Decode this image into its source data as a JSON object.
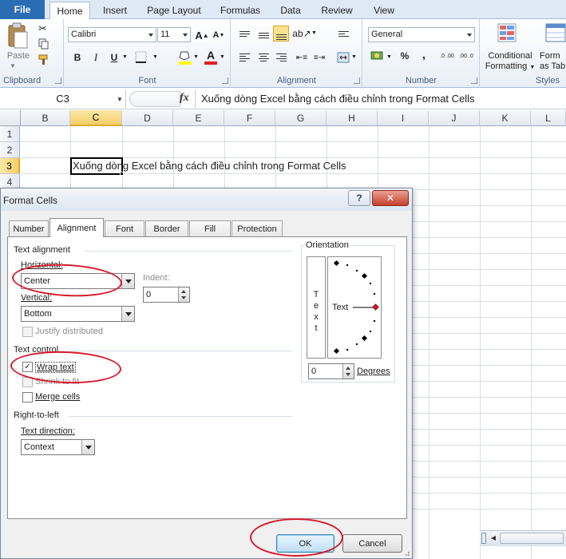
{
  "ribbon_tabs": [
    "File",
    "Home",
    "Insert",
    "Page Layout",
    "Formulas",
    "Data",
    "Review",
    "View"
  ],
  "ribbon": {
    "clipboard": {
      "paste_label": "Paste",
      "group_label": "Clipboard"
    },
    "font": {
      "font_name": "Calibri",
      "font_size": "11",
      "bold": "B",
      "italic": "I",
      "underline": "U",
      "grow": "A",
      "shrink": "A",
      "font_color_letter": "A",
      "group_label": "Font"
    },
    "alignment": {
      "group_label": "Alignment"
    },
    "number": {
      "format": "General",
      "percent": "%",
      "comma": ",",
      "inc_dec": ".0 .00",
      "dec_dec": ".00 .0",
      "group_label": "Number"
    },
    "styles": {
      "conditional_formatting": [
        "Conditional",
        "Formatting"
      ],
      "format_as_table": [
        "Form",
        "as Tab"
      ],
      "group_label": "Styles"
    }
  },
  "formula_bar": {
    "name_box": "C3",
    "fx": "fx",
    "formula": "Xuống dòng Excel bằng cách điều chỉnh trong Format Cells"
  },
  "sheet": {
    "columns": [
      "B",
      "C",
      "D",
      "E",
      "F",
      "G",
      "H",
      "I",
      "J",
      "K",
      "L"
    ],
    "selected_column": "C",
    "rows": [
      "1",
      "2",
      "3",
      "4"
    ],
    "selected_row": "3",
    "cell_c3": "Xuống dòng Excel bằng cách điều chỉnh trong Format Cells"
  },
  "dialog": {
    "title": "Format Cells",
    "help_button": "?",
    "close_button": "✕",
    "tabs": [
      "Number",
      "Alignment",
      "Font",
      "Border",
      "Fill",
      "Protection"
    ],
    "active_tab": "Alignment",
    "text_alignment": {
      "section": "Text alignment",
      "horizontal_label": "Horizontal:",
      "horizontal_value": "Center",
      "indent_label": "Indent:",
      "indent_value": "0",
      "vertical_label": "Vertical:",
      "vertical_value": "Bottom",
      "justify_distributed": "Justify distributed"
    },
    "text_control": {
      "section": "Text control",
      "wrap_text": "Wrap text",
      "wrap_text_checked": true,
      "shrink_to_fit": "Shrink to fit",
      "merge_cells": "Merge cells"
    },
    "right_to_left": {
      "section": "Right-to-left",
      "text_direction_label": "Text direction:",
      "text_direction_value": "Context"
    },
    "orientation": {
      "section": "Orientation",
      "vertical_text": "Text",
      "text_label": "Text",
      "degrees_value": "0",
      "degrees_label": "Degrees"
    },
    "ok_label": "OK",
    "cancel_label": "Cancel"
  },
  "colors": {
    "annotation_red": "#d7192a",
    "file_tab": "#2a6db5",
    "selection_header": "#f3cf6b"
  }
}
